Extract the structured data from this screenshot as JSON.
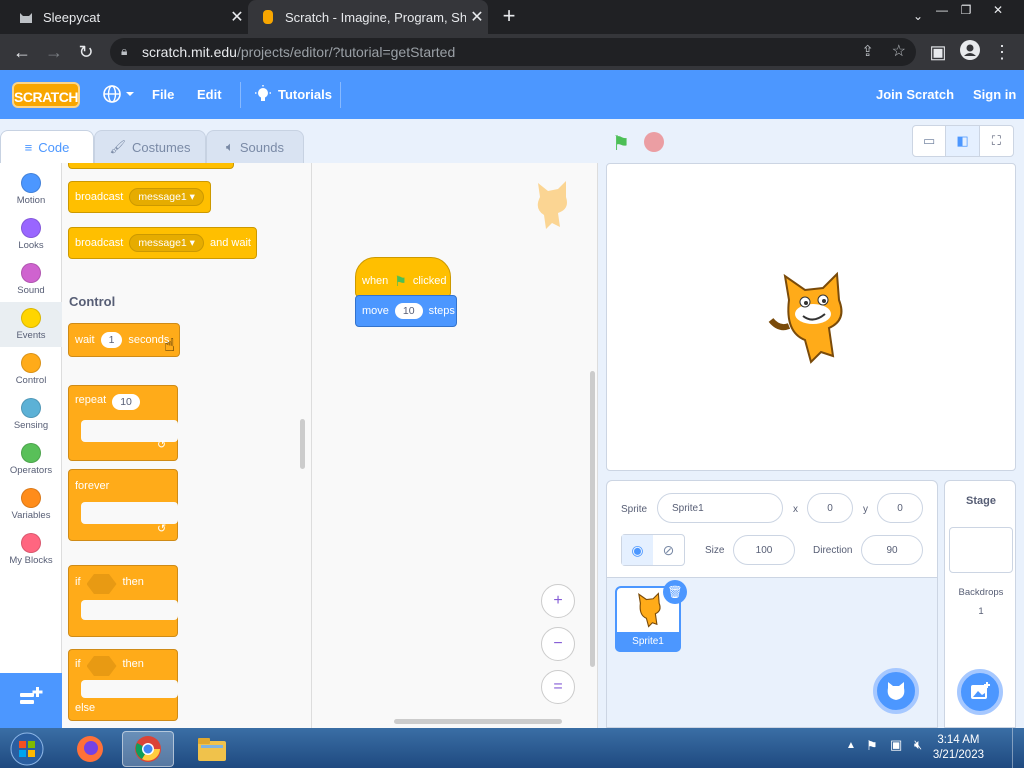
{
  "browser": {
    "tabs": [
      {
        "title": "Sleepycat",
        "close": "✕"
      },
      {
        "title": "Scratch - Imagine, Program, Shar",
        "close": "✕"
      }
    ],
    "new_tab": "+",
    "url_host": "scratch.mit.edu",
    "url_path": "/projects/editor/?tutorial=getStarted"
  },
  "menu": {
    "logo": "SCRATCH",
    "file": "File",
    "edit": "Edit",
    "tutorials": "Tutorials",
    "join": "Join Scratch",
    "signin": "Sign in"
  },
  "editor_tabs": {
    "code": "Code",
    "costumes": "Costumes",
    "sounds": "Sounds"
  },
  "categories": [
    {
      "label": "Motion",
      "color": "#4c97ff"
    },
    {
      "label": "Looks",
      "color": "#9966ff"
    },
    {
      "label": "Sound",
      "color": "#cf63cf"
    },
    {
      "label": "Events",
      "color": "#ffd500"
    },
    {
      "label": "Control",
      "color": "#ffab19"
    },
    {
      "label": "Sensing",
      "color": "#5cb1d6"
    },
    {
      "label": "Operators",
      "color": "#59c059"
    },
    {
      "label": "Variables",
      "color": "#ff8c1a"
    },
    {
      "label": "My Blocks",
      "color": "#ff6680"
    }
  ],
  "palette": {
    "broadcast": "broadcast",
    "message": "message1",
    "broadcast2": "broadcast",
    "message2": "message1",
    "and_wait": "and wait",
    "control_title": "Control",
    "wait": "wait",
    "wait_val": "1",
    "seconds": "seconds",
    "repeat": "repeat",
    "repeat_val": "10",
    "forever": "forever",
    "if1": "if",
    "then1": "then",
    "if2": "if",
    "then2": "then",
    "else": "else"
  },
  "script": {
    "when": "when",
    "clicked": "clicked",
    "move": "move",
    "steps_val": "10",
    "steps": "steps"
  },
  "zoom": {
    "in": "+",
    "out": "−",
    "reset": "="
  },
  "sprite_info": {
    "sprite_label": "Sprite",
    "sprite_name": "Sprite1",
    "x_label": "x",
    "x_val": "0",
    "y_label": "y",
    "y_val": "0",
    "size_label": "Size",
    "size_val": "100",
    "dir_label": "Direction",
    "dir_val": "90"
  },
  "sprite_list": {
    "item": "Sprite1"
  },
  "stage_panel": {
    "title": "Stage",
    "backdrops": "Backdrops",
    "count": "1"
  },
  "taskbar": {
    "time": "3:14 AM",
    "date": "3/21/2023"
  }
}
